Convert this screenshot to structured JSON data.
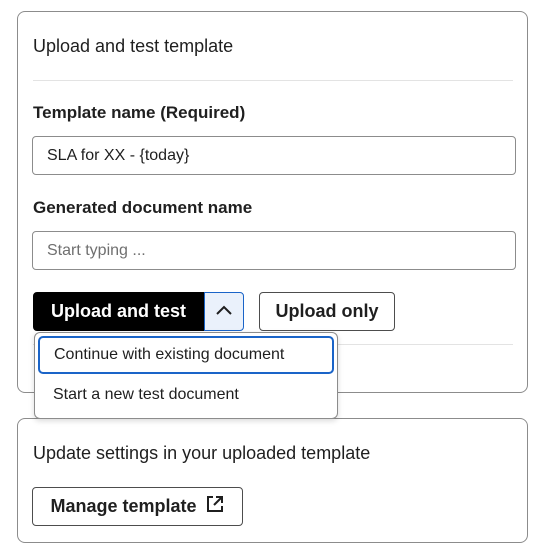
{
  "upload_panel": {
    "title": "Upload and test template",
    "template_name_label": "Template name (Required)",
    "template_name_value": "SLA for XX - {today}",
    "generated_doc_label": "Generated document name",
    "generated_doc_placeholder": "Start typing ...",
    "upload_and_test_label": "Upload and test",
    "toggle_icon": "chevron-up-icon",
    "upload_only_label": "Upload only"
  },
  "dropdown": {
    "items": [
      {
        "label": "Continue with existing document",
        "focused": true
      },
      {
        "label": "Start a new test document",
        "focused": false
      }
    ]
  },
  "settings_panel": {
    "title": "Update settings in your uploaded template",
    "manage_label": "Manage template",
    "manage_icon": "external-link-icon"
  },
  "colors": {
    "primary_button_bg": "#000000",
    "focus_border": "#1a64c8",
    "panel_border": "#8c8c8c"
  }
}
